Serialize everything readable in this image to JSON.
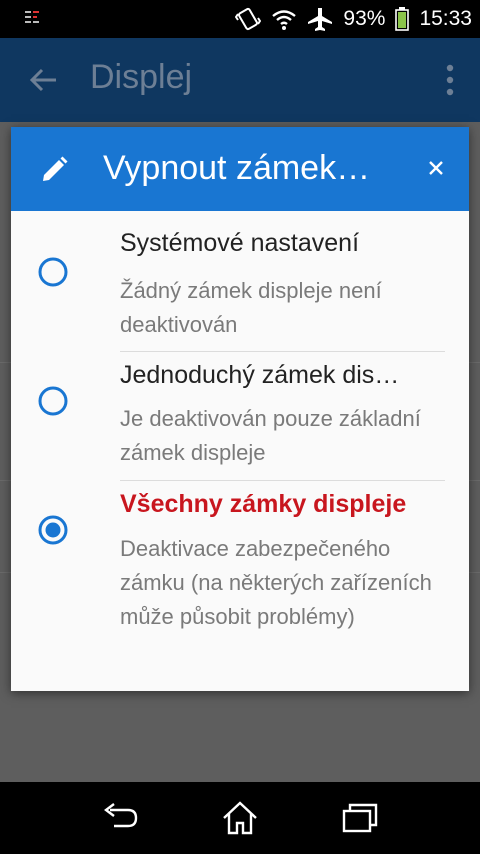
{
  "status_bar": {
    "battery_percent": "93%",
    "time": "15:33",
    "icons": [
      "notification-icon",
      "vibrate-icon",
      "wifi-icon",
      "airplane-mode-icon",
      "battery-icon"
    ]
  },
  "app_bar": {
    "title": "Displej",
    "icons": [
      "back-arrow-icon",
      "more-vert-icon"
    ]
  },
  "dialog": {
    "title": "Vypnout zámek…",
    "header_color": "#1976d2",
    "icons": [
      "pencil-icon",
      "close-icon"
    ],
    "options": [
      {
        "title": "Systémové nastavení",
        "description": "Žádný zámek displeje není deaktivován",
        "selected": false
      },
      {
        "title": "Jednoduchý zámek dis…",
        "description": "Je deaktivován pouze základní zámek displeje",
        "selected": false
      },
      {
        "title": "Všechny zámky displeje",
        "description": "Deaktivace zabezpečeného zámku (na některých zařízeních může působit problémy)",
        "selected": true
      }
    ],
    "accent_selected_title": "#c8161e",
    "radio_color": "#1976d2"
  },
  "nav_bar": {
    "icons": [
      "back-icon",
      "home-icon",
      "recent-apps-icon"
    ]
  }
}
